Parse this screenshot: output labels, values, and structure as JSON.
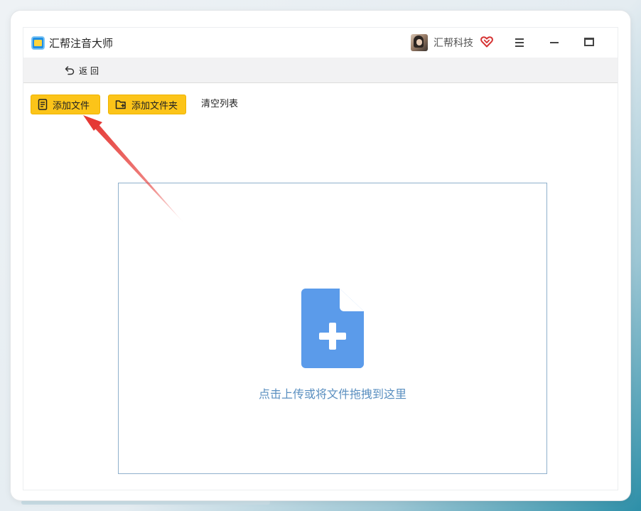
{
  "app": {
    "title": "汇帮注音大师",
    "logo_icon": "app-logo-icon"
  },
  "account": {
    "company": "汇帮科技",
    "vip_icon": "vip-heart-icon"
  },
  "window_controls": {
    "menu_icon": "hamburger-menu-icon",
    "minimize_icon": "minimize-icon",
    "maximize_icon": "maximize-icon"
  },
  "toolbar": {
    "back_label": "返回",
    "back_icon": "undo-arrow-icon"
  },
  "actions": {
    "add_file": "添加文件",
    "add_folder": "添加文件夹",
    "clear_list": "清空列表"
  },
  "dropzone": {
    "hint": "点击上传或将文件拖拽到这里",
    "icon": "file-plus-icon"
  },
  "colors": {
    "accent_yellow": "#fcc419",
    "dropzone_border": "#8fb0cc",
    "icon_blue": "#5b9bea",
    "hint_text": "#5a8fc0",
    "annotation_red": "#e53935"
  }
}
